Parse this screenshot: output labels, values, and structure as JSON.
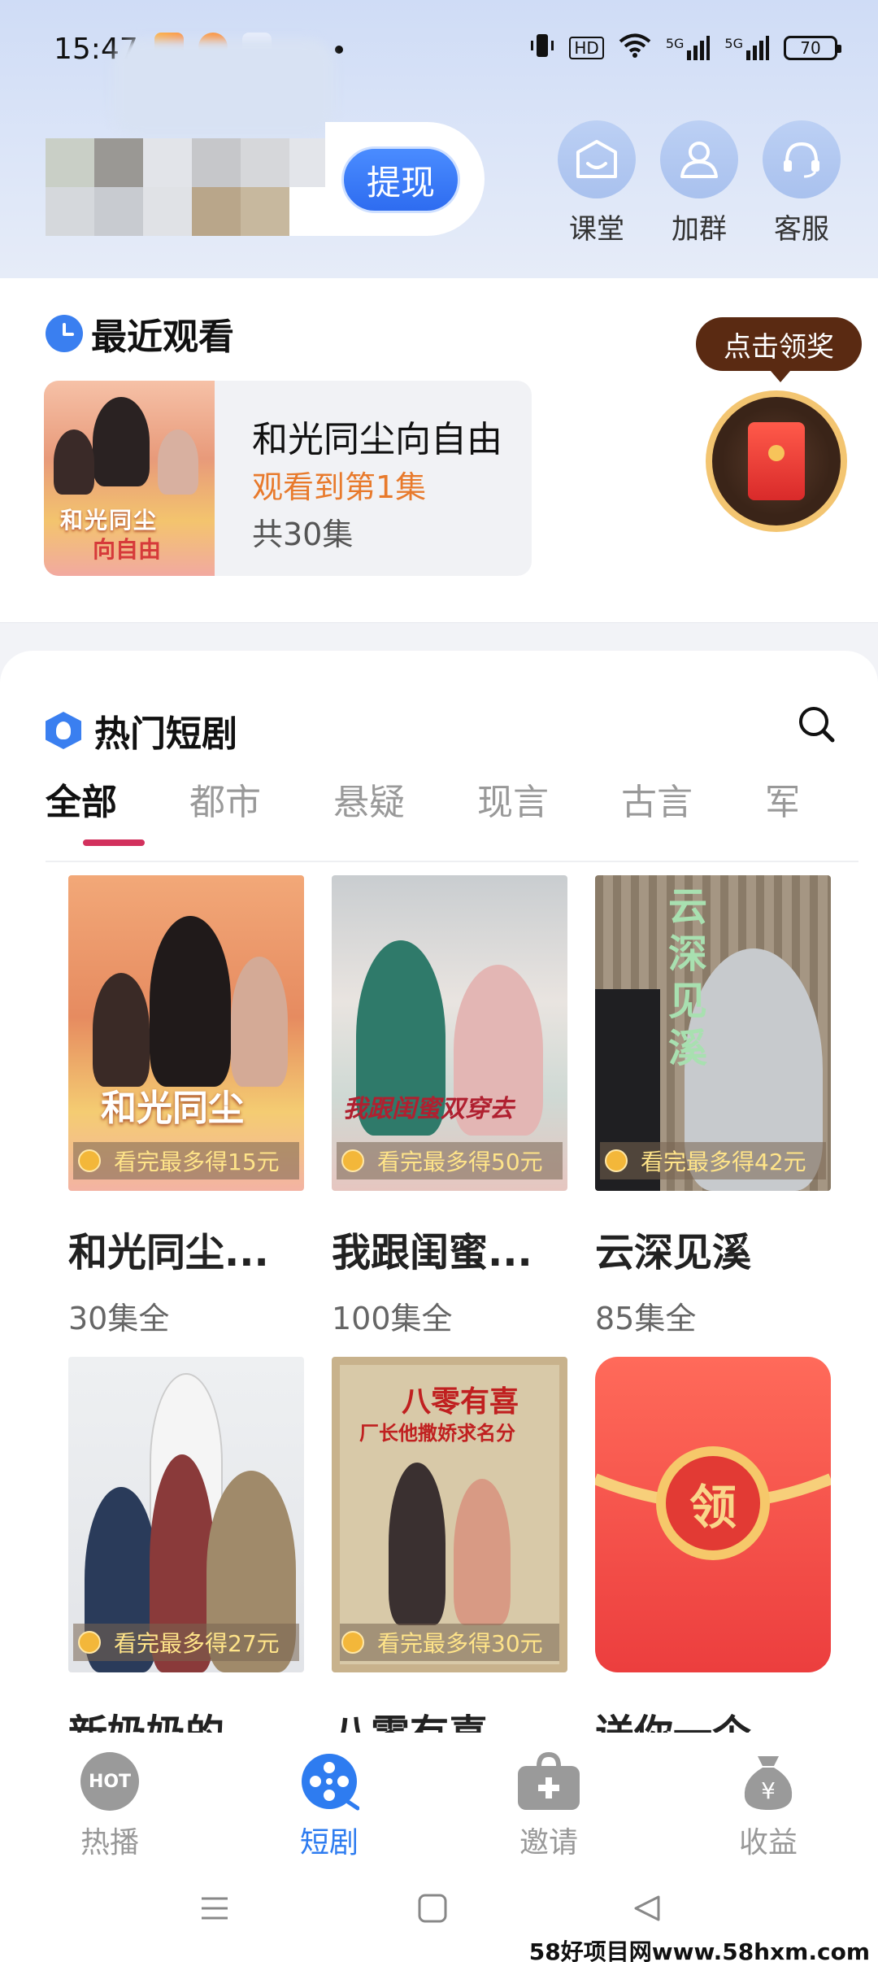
{
  "status_bar": {
    "time": "15:47",
    "network": "HD",
    "signal1": "5G",
    "signal2": "5G",
    "battery": "70"
  },
  "header": {
    "withdraw_label": "提现",
    "actions": [
      {
        "label": "课堂",
        "icon": "classroom-icon"
      },
      {
        "label": "加群",
        "icon": "group-icon"
      },
      {
        "label": "客服",
        "icon": "headset-icon"
      }
    ]
  },
  "recent": {
    "title": "最近观看",
    "drama_name": "和光同尘向自由",
    "progress": "观看到第1集",
    "total": "共30集",
    "poster_text1": "和光同尘",
    "poster_text2": "向自由"
  },
  "reward": {
    "label": "点击领奖"
  },
  "hot": {
    "title": "热门短剧",
    "tabs": [
      "全部",
      "都市",
      "悬疑",
      "现言",
      "古言",
      "军"
    ],
    "active_tab": 0,
    "items": [
      {
        "title": "和光同尘...",
        "episodes": "30集全",
        "badge": "看完最多得15元",
        "poster_text": "和光同尘"
      },
      {
        "title": "我跟闺蜜...",
        "episodes": "100集全",
        "badge": "看完最多得50元",
        "poster_text": "我跟闺蜜双穿去"
      },
      {
        "title": "云深见溪",
        "episodes": "85集全",
        "badge": "看完最多得42元",
        "poster_text": "云深见溪"
      },
      {
        "title": "新奶奶的",
        "episodes": "",
        "badge": "看完最多得27元",
        "poster_text": ""
      },
      {
        "title": "八零有喜",
        "episodes": "",
        "badge": "看完最多得30元",
        "poster_text": "八零有喜",
        "poster_sub": "厂长他撒娇求名分"
      },
      {
        "title": "送你一个",
        "episodes": "",
        "badge": "",
        "poster_text": "领"
      }
    ]
  },
  "bottom_nav": [
    {
      "label": "热播",
      "icon": "hot-icon",
      "icon_text": "HOT"
    },
    {
      "label": "短剧",
      "icon": "film-reel-icon"
    },
    {
      "label": "邀请",
      "icon": "gift-box-icon"
    },
    {
      "label": "收益",
      "icon": "money-bag-icon"
    }
  ],
  "watermark": "58好项目网www.58hxm.com",
  "colors": {
    "accent_blue": "#2e7cf0",
    "tab_underline": "#d2315d",
    "progress_orange": "#e87a2c",
    "reward_brown": "#5a2a12"
  }
}
